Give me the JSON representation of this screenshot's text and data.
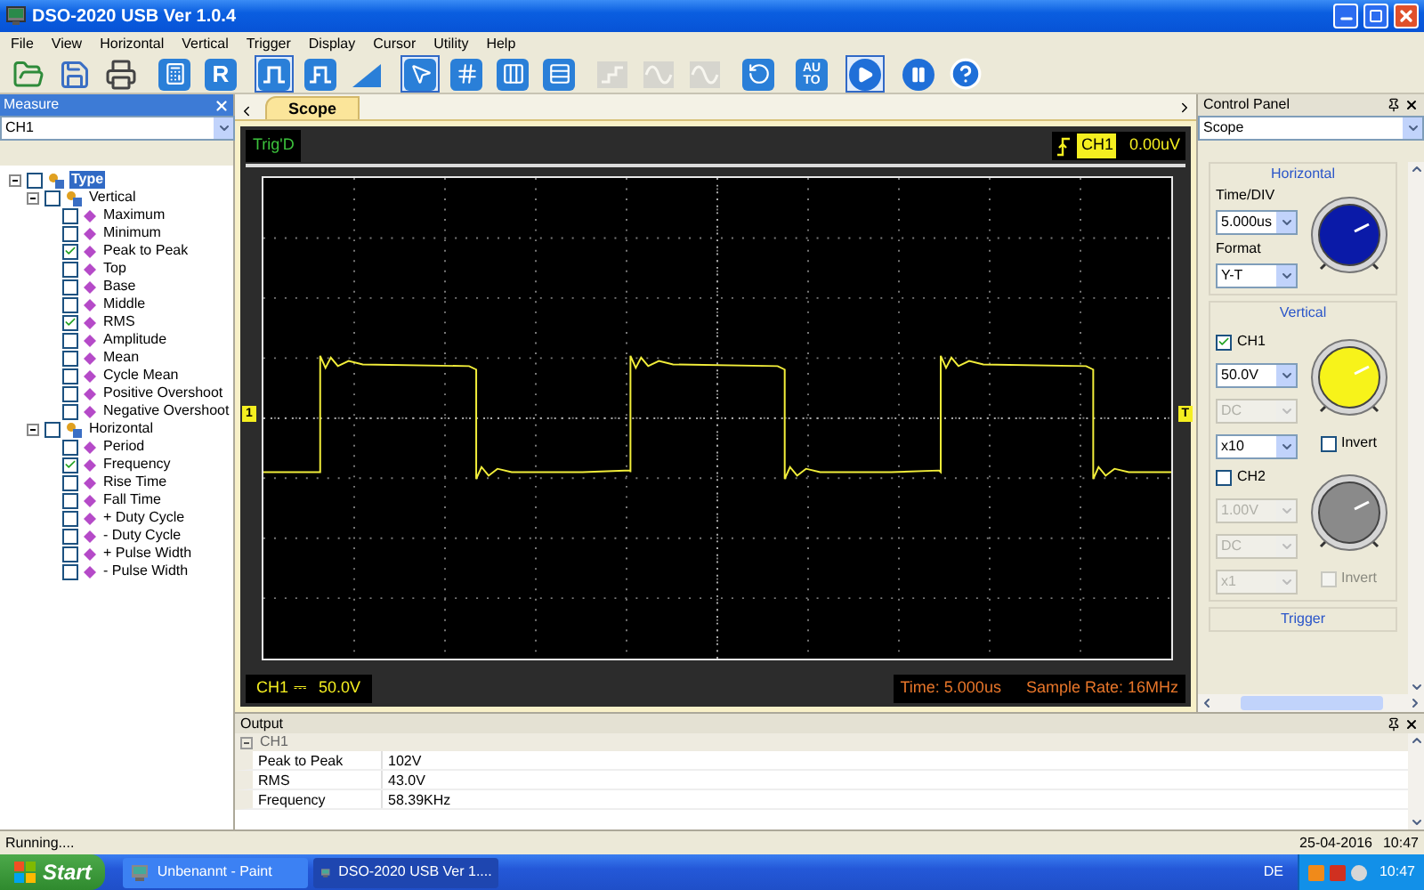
{
  "window": {
    "title": "DSO-2020 USB Ver 1.0.4"
  },
  "menu": [
    "File",
    "View",
    "Horizontal",
    "Vertical",
    "Trigger",
    "Display",
    "Cursor",
    "Utility",
    "Help"
  ],
  "toolbar": [
    {
      "kind": "open",
      "selected": false,
      "disabled": false
    },
    {
      "kind": "save",
      "selected": false,
      "disabled": false
    },
    {
      "kind": "print",
      "selected": false,
      "disabled": false
    },
    {
      "kind": "math",
      "selected": false,
      "disabled": false
    },
    {
      "kind": "text",
      "label": "R",
      "selected": false,
      "disabled": false
    },
    {
      "kind": "pulse",
      "selected": true,
      "disabled": false
    },
    {
      "kind": "pulse2",
      "selected": false,
      "disabled": false
    },
    {
      "kind": "ramp",
      "selected": false,
      "disabled": false
    },
    {
      "kind": "pointer",
      "selected": true,
      "disabled": false
    },
    {
      "kind": "crosshair",
      "selected": false,
      "disabled": false
    },
    {
      "kind": "vcursor",
      "selected": false,
      "disabled": false
    },
    {
      "kind": "hcursor",
      "selected": false,
      "disabled": false
    },
    {
      "kind": "step",
      "selected": false,
      "disabled": true
    },
    {
      "kind": "sine",
      "selected": false,
      "disabled": true
    },
    {
      "kind": "sine",
      "selected": false,
      "disabled": true
    },
    {
      "kind": "undo",
      "selected": false,
      "disabled": false
    },
    {
      "kind": "text",
      "label": "AUTO",
      "selected": false,
      "disabled": false
    },
    {
      "kind": "run",
      "selected": true,
      "disabled": false
    },
    {
      "kind": "pause",
      "selected": false,
      "disabled": false
    },
    {
      "kind": "help",
      "selected": false,
      "disabled": false
    }
  ],
  "measure": {
    "title": "Measure",
    "channel": "CH1",
    "tree": [
      {
        "label": "Type",
        "checked": false,
        "selected": true,
        "expanded": true,
        "children": [
          {
            "label": "Vertical",
            "checked": false,
            "selected": false,
            "expanded": true,
            "children": [
              {
                "label": "Maximum",
                "checked": false,
                "selected": false
              },
              {
                "label": "Minimum",
                "checked": false,
                "selected": false
              },
              {
                "label": "Peak to Peak",
                "checked": true,
                "selected": false
              },
              {
                "label": "Top",
                "checked": false,
                "selected": false
              },
              {
                "label": "Base",
                "checked": false,
                "selected": false
              },
              {
                "label": "Middle",
                "checked": false,
                "selected": false
              },
              {
                "label": "RMS",
                "checked": true,
                "selected": false
              },
              {
                "label": "Amplitude",
                "checked": false,
                "selected": false
              },
              {
                "label": "Mean",
                "checked": false,
                "selected": false
              },
              {
                "label": "Cycle Mean",
                "checked": false,
                "selected": false
              },
              {
                "label": "Positive Overshoot",
                "checked": false,
                "selected": false
              },
              {
                "label": "Negative Overshoot",
                "checked": false,
                "selected": false
              }
            ]
          },
          {
            "label": "Horizontal",
            "checked": false,
            "selected": false,
            "expanded": true,
            "children": [
              {
                "label": "Period",
                "checked": false,
                "selected": false
              },
              {
                "label": "Frequency",
                "checked": true,
                "selected": false
              },
              {
                "label": "Rise Time",
                "checked": false,
                "selected": false
              },
              {
                "label": "Fall Time",
                "checked": false,
                "selected": false
              },
              {
                "label": "+ Duty Cycle",
                "checked": false,
                "selected": false
              },
              {
                "label": "- Duty Cycle",
                "checked": false,
                "selected": false
              },
              {
                "label": "+ Pulse Width",
                "checked": false,
                "selected": false
              },
              {
                "label": "- Pulse Width",
                "checked": false,
                "selected": false
              }
            ]
          }
        ]
      }
    ]
  },
  "scope": {
    "tab": "Scope",
    "trig_status": "Trig'D",
    "trigger_channel": "CH1",
    "trigger_level": "0.00uV",
    "channel_marker": "1",
    "trigger_marker": "T",
    "channel_readout": "CH1",
    "coupling_symbol": "⎓",
    "volts_div": "50.0V",
    "time_readout": "Time: 5.000us",
    "sample_rate": "Sample Rate: 16MHz"
  },
  "control_panel": {
    "title": "Control Panel",
    "mode": "Scope",
    "horizontal": {
      "heading": "Horizontal",
      "time_div_label": "Time/DIV",
      "time_div": "5.000us",
      "format_label": "Format",
      "format": "Y-T",
      "color": "#0a1aa8"
    },
    "vertical_heading": "Vertical",
    "channels": [
      {
        "name": "CH1",
        "enabled": true,
        "volts": "50.0V",
        "coupling": "DC",
        "coupling_disabled": true,
        "probe": "x10",
        "invert_label": "Invert",
        "inverted": false,
        "color": "#f7f31a"
      },
      {
        "name": "CH2",
        "enabled": false,
        "volts": "1.00V",
        "coupling": "DC",
        "coupling_disabled": true,
        "probe": "x1",
        "invert_label": "Invert",
        "inverted": false,
        "color": "#8a8a8a"
      }
    ],
    "trigger_heading": "Trigger"
  },
  "output": {
    "title": "Output",
    "groups": [
      {
        "name": "CH1",
        "expanded": true,
        "rows": [
          {
            "name": "Peak to Peak",
            "value": "102V"
          },
          {
            "name": "RMS",
            "value": "43.0V"
          },
          {
            "name": "Frequency",
            "value": "58.39KHz"
          }
        ]
      }
    ]
  },
  "status_bar": {
    "text": "Running....",
    "date": "25-04-2016",
    "time": "10:47"
  },
  "taskbar": {
    "start": "Start",
    "tasks": [
      {
        "label": "Unbenannt - Paint",
        "selected": false
      },
      {
        "label": "DSO-2020 USB Ver 1....",
        "selected": true
      }
    ],
    "language": "DE",
    "clock": "10:47"
  }
}
